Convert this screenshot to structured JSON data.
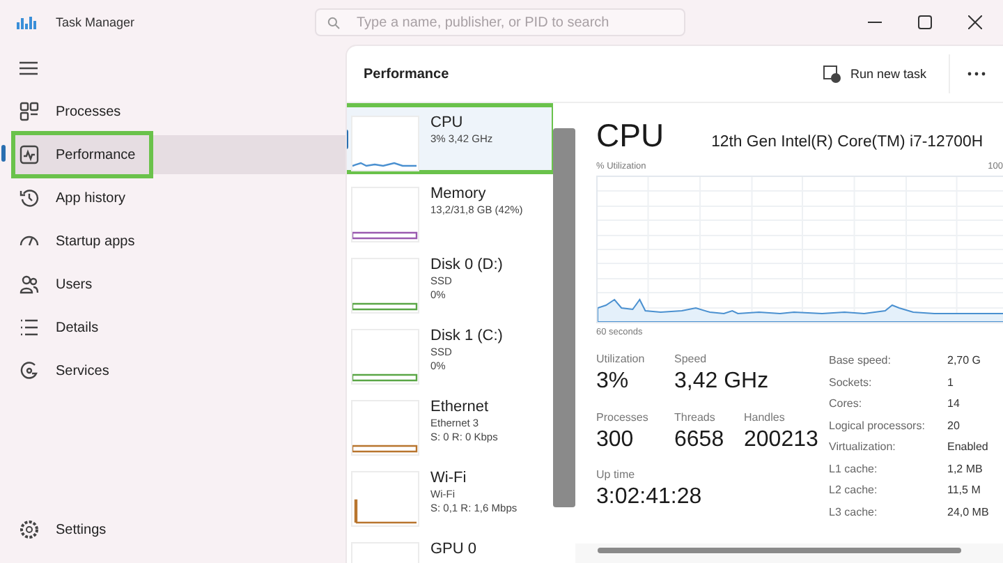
{
  "window": {
    "title": "Task Manager",
    "search_placeholder": "Type a name, publisher, or PID to search"
  },
  "sidebar": {
    "items": [
      {
        "kind": "processes",
        "label": "Processes",
        "selected": false,
        "highlighted": false
      },
      {
        "kind": "performance",
        "label": "Performance",
        "selected": true,
        "highlighted": true
      },
      {
        "kind": "history",
        "label": "App history",
        "selected": false,
        "highlighted": false
      },
      {
        "kind": "startup",
        "label": "Startup apps",
        "selected": false,
        "highlighted": false
      },
      {
        "kind": "users",
        "label": "Users",
        "selected": false,
        "highlighted": false
      },
      {
        "kind": "details",
        "label": "Details",
        "selected": false,
        "highlighted": false
      },
      {
        "kind": "services",
        "label": "Services",
        "selected": false,
        "highlighted": false
      }
    ],
    "footer": "Settings"
  },
  "header": {
    "title": "Performance",
    "action": "Run new task"
  },
  "devices": [
    {
      "name": "CPU",
      "lines": [
        "3% 3,42 GHz"
      ],
      "selected": true,
      "highlighted": true,
      "color": "#4a90d0"
    },
    {
      "name": "Memory",
      "lines": [
        "13,2/31,8 GB (42%)"
      ],
      "selected": false,
      "highlighted": false,
      "color": "#9a5bb0"
    },
    {
      "name": "Disk 0 (D:)",
      "lines": [
        "SSD",
        "0%"
      ],
      "selected": false,
      "highlighted": false,
      "color": "#5aa646"
    },
    {
      "name": "Disk 1 (C:)",
      "lines": [
        "SSD",
        "0%"
      ],
      "selected": false,
      "highlighted": false,
      "color": "#5aa646"
    },
    {
      "name": "Ethernet",
      "lines": [
        "Ethernet 3",
        "S: 0 R: 0 Kbps"
      ],
      "selected": false,
      "highlighted": false,
      "color": "#b8752e"
    },
    {
      "name": "Wi-Fi",
      "lines": [
        "Wi-Fi",
        "S: 0,1 R: 1,6 Mbps"
      ],
      "selected": false,
      "highlighted": false,
      "color": "#b8752e"
    },
    {
      "name": "GPU 0",
      "selected": false,
      "highlighted": false
    }
  ],
  "detail": {
    "title": "CPU",
    "model": "12th Gen Intel(R) Core(TM) i7-12700H",
    "graph_label": "% Utilization",
    "graph_max": "100",
    "graph_time": "60 seconds",
    "stats": [
      {
        "label": "Utilization",
        "value": "3%"
      },
      {
        "label": "Speed",
        "value": "3,42 GHz"
      },
      {
        "label": "Processes",
        "value": "300"
      },
      {
        "label": "Threads",
        "value": "6658"
      },
      {
        "label": "Handles",
        "value": "200213"
      },
      {
        "label": "Up time",
        "value": "3:02:41:28"
      }
    ],
    "specs": [
      {
        "label": "Base speed:",
        "value": "2,70 G"
      },
      {
        "label": "Sockets:",
        "value": "1"
      },
      {
        "label": "Cores:",
        "value": "14"
      },
      {
        "label": "Logical processors:",
        "value": "20"
      },
      {
        "label": "Virtualization:",
        "value": "Enabled"
      },
      {
        "label": "L1 cache:",
        "value": "1,2 MB"
      },
      {
        "label": "L2 cache:",
        "value": "11,5 M"
      },
      {
        "label": "L3 cache:",
        "value": "24,0 MB"
      }
    ]
  }
}
